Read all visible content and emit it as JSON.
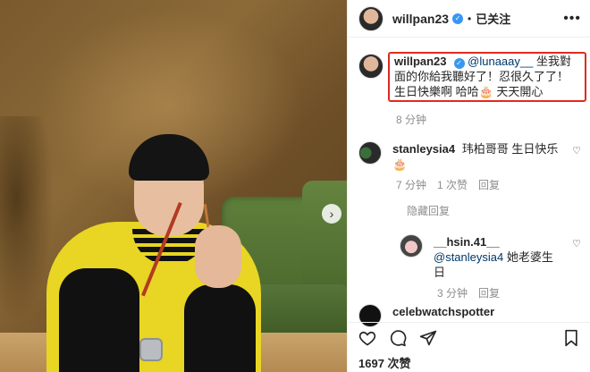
{
  "post": {
    "username": "willpan23",
    "follow_status": "已关注",
    "caption": {
      "mention": "@lunaaay__",
      "text": "坐我對面的你給我聽好了！忍很久了了！生日快樂啊 哈哈🎂 天天開心",
      "time": "8 分钟"
    }
  },
  "comments": [
    {
      "username": "stanleysia4",
      "text": "玮柏哥哥 生日快乐🎂",
      "time": "7 分钟",
      "likes": "1 次赞",
      "reply_label": "回复"
    }
  ],
  "hide_replies": "隐藏回复",
  "reply": {
    "username": "__hsin.41__",
    "mention": "@stanleysia4",
    "text": "她老婆生日",
    "time": "3 分钟",
    "reply_label": "回复"
  },
  "next_comment": {
    "username": "celebwatchspotter"
  },
  "likes_count": "1697 次赞",
  "colors": {
    "highlight": "#e02a1f",
    "verified": "#3897f0",
    "mention": "#00376b"
  }
}
